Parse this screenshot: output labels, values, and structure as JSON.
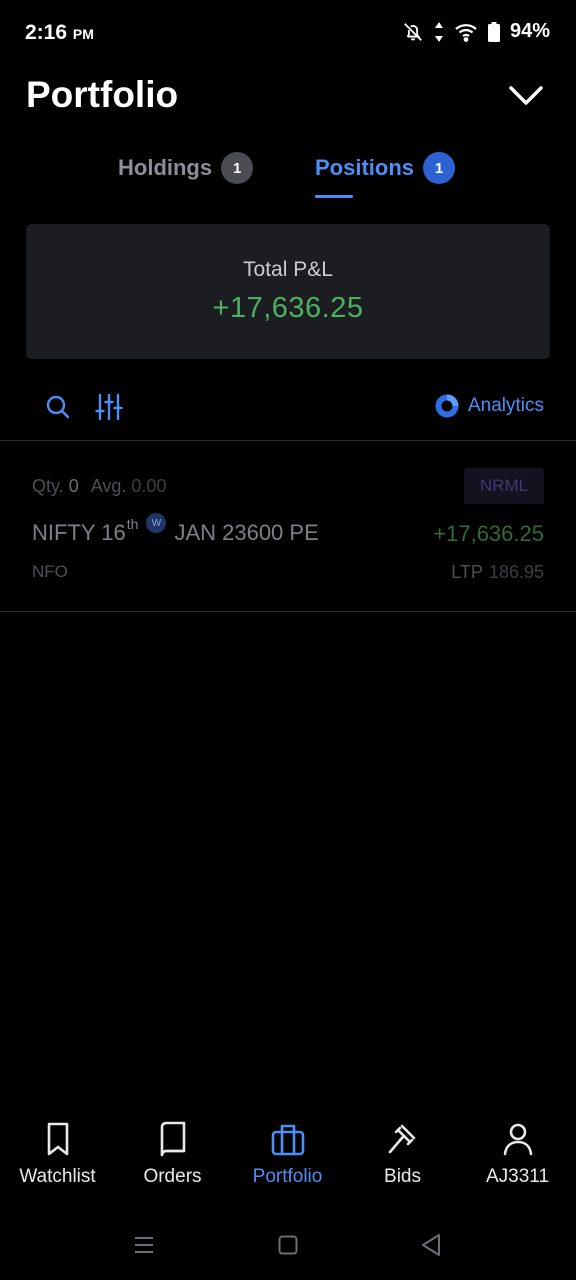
{
  "status_bar": {
    "time": "2:16",
    "ampm": "PM",
    "battery": "94%"
  },
  "header": {
    "title": "Portfolio"
  },
  "tabs": [
    {
      "label": "Holdings",
      "count": "1",
      "active": false
    },
    {
      "label": "Positions",
      "count": "1",
      "active": true
    }
  ],
  "pnl": {
    "label": "Total P&L",
    "value": "+17,636.25"
  },
  "toolbar": {
    "analytics_label": "Analytics"
  },
  "position": {
    "qty_label": "Qty.",
    "qty_value": "0",
    "avg_label": "Avg.",
    "avg_value": "0.00",
    "product": "NRML",
    "symbol_name": "NIFTY 16",
    "symbol_suffix": "th",
    "weekly_badge": "W",
    "symbol_rest": "JAN 23600 PE",
    "pnl": "+17,636.25",
    "exchange": "NFO",
    "ltp_label": "LTP",
    "ltp_value": "186.95"
  },
  "bottom_nav": [
    {
      "label": "Watchlist",
      "icon": "bookmark-icon",
      "active": false
    },
    {
      "label": "Orders",
      "icon": "book-icon",
      "active": false
    },
    {
      "label": "Portfolio",
      "icon": "briefcase-icon",
      "active": true
    },
    {
      "label": "Bids",
      "icon": "gavel-icon",
      "active": false
    },
    {
      "label": "AJ3311",
      "icon": "user-icon",
      "active": false
    }
  ],
  "colors": {
    "accent": "#4e8ef7",
    "profit": "#4caf61",
    "background": "#000000",
    "card": "#1b1d21"
  }
}
